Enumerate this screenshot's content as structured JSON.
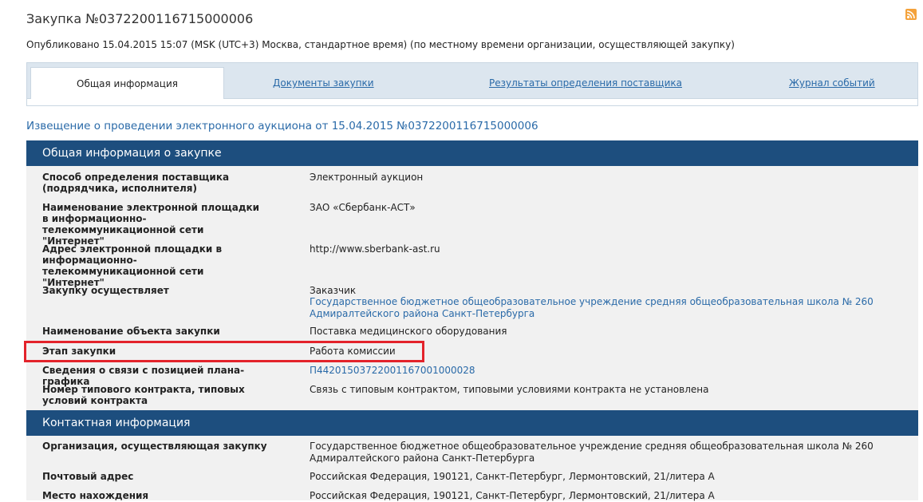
{
  "header": {
    "title": "Закупка №0372200116715000006",
    "published": "Опубликовано 15.04.2015 15:07 (MSK (UTC+3) Москва, стандартное время) (по местному времени организации, осуществляющей закупку)",
    "rss_icon": "rss-icon"
  },
  "tabs": {
    "active": "Общая информация",
    "documents": "Документы закупки",
    "results": "Результаты определения поставщика",
    "journal": "Журнал событий"
  },
  "notice_title": "Извещение о проведении электронного аукциона от 15.04.2015 №0372200116715000006",
  "general": {
    "header": "Общая информация о закупке",
    "rows": [
      {
        "label": "Способ определения поставщика (подрядчика, исполнителя)",
        "value": "Электронный аукцион"
      },
      {
        "label": "Наименование электронной площадки в информационно-телекоммуникационной сети \"Интернет\"",
        "value": "ЗАО «Сбербанк-АСТ»"
      },
      {
        "label": "Адрес электронной площадки в информационно-телекоммуникационной сети \"Интернет\"",
        "value": "http://www.sberbank-ast.ru"
      },
      {
        "label": "Закупку осуществляет",
        "value": "Заказчик",
        "value_link": "Государственное бюджетное общеобразовательное учреждение средняя общеобразовательная школа № 260 Адмиралтейского района Санкт-Петербурга"
      },
      {
        "label": "Наименование объекта закупки",
        "value": "Поставка медицинского оборудования"
      },
      {
        "label": "Этап закупки",
        "value": "Работа комиссии"
      },
      {
        "label": "Сведения о связи с позицией плана-графика",
        "value_link": "П44201503722001167001000028"
      },
      {
        "label": "Номер типового контракта, типовых условий контракта",
        "value": "Связь с типовым контрактом, типовыми условиями контракта не установлена"
      }
    ]
  },
  "contact": {
    "header": "Контактная информация",
    "rows": [
      {
        "label": "Организация, осуществляющая закупку",
        "value": "Государственное бюджетное общеобразовательное учреждение средняя общеобразовательная школа № 260 Адмиралтейского района Санкт-Петербурга"
      },
      {
        "label": "Почтовый адрес",
        "value": "Российская Федерация, 190121, Санкт-Петербург, Лермонтовский, 21/литера А"
      },
      {
        "label": "Место нахождения",
        "value": "Российская Федерация, 190121, Санкт-Петербург, Лермонтовский, 21/литера А"
      }
    ]
  }
}
